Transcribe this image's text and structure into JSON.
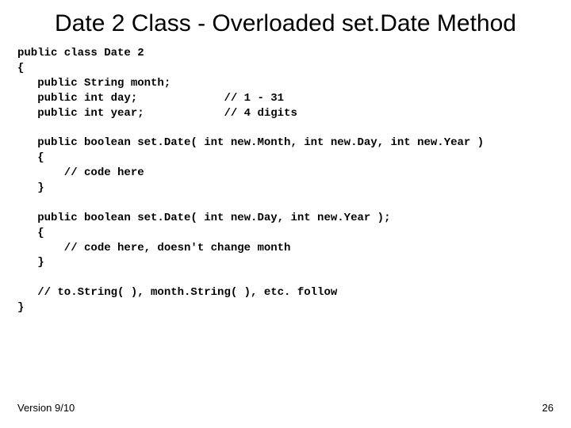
{
  "title": "Date 2 Class - Overloaded set.Date Method",
  "code": "public class Date 2\n{\n   public String month;\n   public int day;             // 1 - 31\n   public int year;            // 4 digits\n\n   public boolean set.Date( int new.Month, int new.Day, int new.Year )\n   {\n       // code here\n   }\n\n   public boolean set.Date( int new.Day, int new.Year );\n   {\n       // code here, doesn't change month\n   }\n\n   // to.String( ), month.String( ), etc. follow\n}",
  "footer": {
    "version": "Version 9/10",
    "page": "26"
  }
}
